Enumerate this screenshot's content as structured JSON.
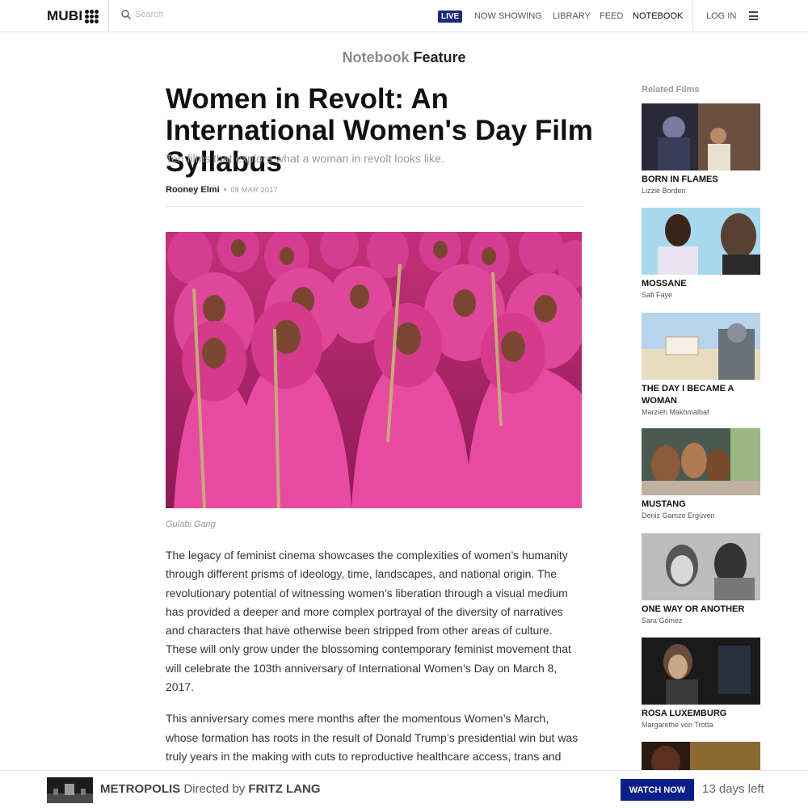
{
  "header": {
    "logo_text": "MUBI",
    "search_placeholder": "Search",
    "nav": {
      "live": "LIVE",
      "now_showing": "NOW SHOWING",
      "library": "LIBRARY",
      "feed": "FEED",
      "notebook": "NOTEBOOK",
      "login": "LOG IN"
    }
  },
  "article": {
    "kicker_section": "Notebook",
    "kicker_type": "Feature",
    "title": "Women in Revolt: An International Women's Day Film Syllabus",
    "subtitle": "Ten films that explore what a woman in revolt looks like.",
    "author": "Rooney Elmi",
    "date": "08 MAR 2017",
    "image_caption": "Gulabi Gang",
    "paragraphs": [
      "The legacy of feminist cinema showcases the complexities of women’s humanity through different prisms of ideology, time, landscapes, and national origin. The revolutionary potential of witnessing women’s liberation through a visual medium has provided a deeper and more complex portrayal of the diversity of narratives and characters that have otherwise been stripped from other areas of culture. These will only grow under the blossoming contemporary feminist movement that will celebrate the 103th anniversary of International Women’s Day on March 8, 2017.",
      "This anniversary comes mere months after the momentous Women’s March, whose formation has roots in the result of Donald Trump’s presidential win but was truly years in the making with cuts to reproductive healthcare access, trans and queer civil rights, and general inadequacies towards women. The galvanization of millions"
    ]
  },
  "related": {
    "heading": "Related Films",
    "films": [
      {
        "title": "BORN IN FLAMES",
        "director": "Lizzie Borden"
      },
      {
        "title": "MOSSANE",
        "director": "Safi Faye"
      },
      {
        "title": "THE DAY I BECAME A WOMAN",
        "director": "Marzieh Makhmalbaf"
      },
      {
        "title": "MUSTANG",
        "director": "Deniz Gamze Ergüven"
      },
      {
        "title": "ONE WAY OR ANOTHER",
        "director": "Sara Gómez"
      },
      {
        "title": "ROSA LUXEMBURG",
        "director": "Margarethe von Trotta"
      }
    ]
  },
  "bottom_bar": {
    "film_title": "METROPOLIS",
    "directed_by": "Directed by",
    "director": "FRITZ LANG",
    "button_label": "WATCH NOW",
    "days_left": "13 days left"
  },
  "colors": {
    "live_badge": "#1c2a7a",
    "watch_button": "#0b1f8a",
    "kicker_gray": "#8b8b8b"
  }
}
